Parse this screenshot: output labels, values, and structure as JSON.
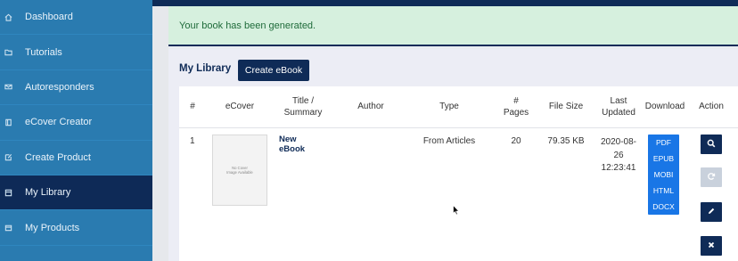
{
  "sidebar": {
    "items": [
      {
        "label": "Dashboard",
        "icon": "home-icon"
      },
      {
        "label": "Tutorials",
        "icon": "folder-icon"
      },
      {
        "label": "Autoresponders",
        "icon": "mail-icon"
      },
      {
        "label": "eCover Creator",
        "icon": "book-icon"
      },
      {
        "label": "Create Product",
        "icon": "edit-icon"
      },
      {
        "label": "My Library",
        "icon": "library-icon",
        "active": true
      },
      {
        "label": "My Products",
        "icon": "box-icon"
      }
    ]
  },
  "alert": {
    "message": "Your book has been generated."
  },
  "library": {
    "title": "My Library",
    "create_label": "Create eBook",
    "columns": {
      "num": "#",
      "ecover": "eCover",
      "title_line1": "Title /",
      "title_line2": "Summary",
      "author": "Author",
      "type": "Type",
      "pages_line1": "#",
      "pages_line2": "Pages",
      "filesize": "File Size",
      "updated_line1": "Last",
      "updated_line2": "Updated",
      "download": "Download",
      "action": "Action"
    },
    "rows": [
      {
        "num": "1",
        "cover_line1": "No Cover",
        "cover_line2": "Image Available",
        "title_line1": "New",
        "title_line2": "eBook",
        "author": "",
        "type": "From Articles",
        "pages": "20",
        "filesize": "79.35 KB",
        "updated_line1": "2020-08-",
        "updated_line2": "26",
        "updated_line3": "12:23:41",
        "downloads": [
          "PDF",
          "EPUB",
          "MOBI",
          "HTML",
          "DOCX"
        ]
      }
    ]
  },
  "colors": {
    "sidebar": "#2a7bb0",
    "sidebar_active": "#0e2a57",
    "navy": "#0f2b57",
    "download_blue": "#1976e6",
    "alert_bg": "#d6f0de",
    "alert_text": "#1f6b3a"
  }
}
